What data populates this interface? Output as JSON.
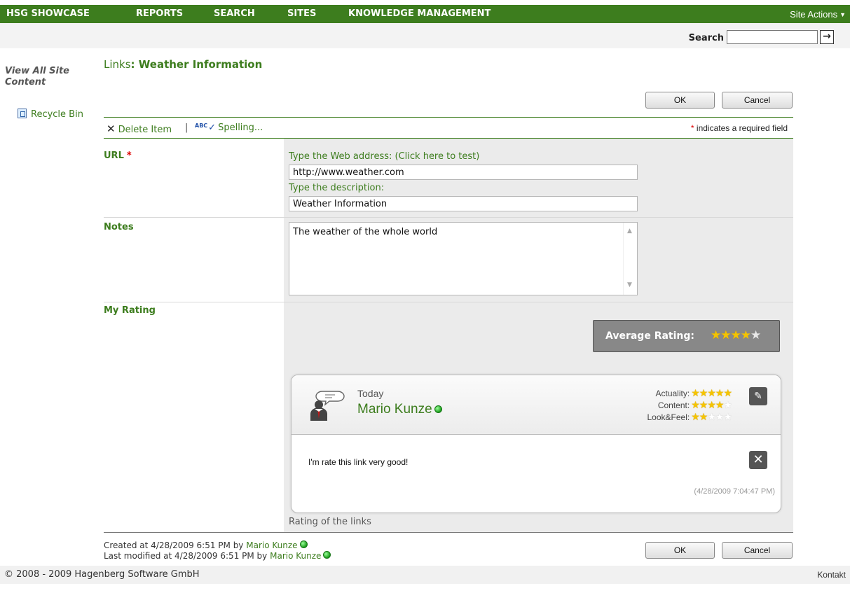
{
  "topnav": {
    "items": [
      "HSG SHOWCASE",
      "REPORTS",
      "SEARCH",
      "SITES",
      "KNOWLEDGE MANAGEMENT"
    ],
    "site_actions": "Site Actions",
    "color": "#3d7d1e"
  },
  "search": {
    "label": "Search",
    "value": "",
    "go_icon": "arrow-right-icon"
  },
  "leftnav": {
    "view_all": "View All Site Content",
    "recycle_bin": "Recycle Bin"
  },
  "title": {
    "prefix": "Links",
    "item": ": Weather Information"
  },
  "buttons": {
    "ok": "OK",
    "cancel": "Cancel"
  },
  "toolbar": {
    "delete": "Delete Item",
    "separator": "|",
    "spelling": "Spelling...",
    "required_marker": "*",
    "required_text": "indicates a required field"
  },
  "form": {
    "url": {
      "label": "URL",
      "required": "*",
      "address_label": "Type the Web address: (Click here to test)",
      "address_value": "http://www.weather.com",
      "description_label": "Type the description:",
      "description_value": "Weather Information"
    },
    "notes": {
      "label": "Notes",
      "value": "The weather of the whole world"
    },
    "rating": {
      "label": "My Rating",
      "average_label": "Average Rating:",
      "average_stars": 4.5,
      "card": {
        "when": "Today",
        "user": "Mario Kunze",
        "criteria": [
          {
            "name": "Actuality:",
            "stars": 5
          },
          {
            "name": "Content:",
            "stars": 4
          },
          {
            "name": "Look&Feel:",
            "stars": 2
          }
        ],
        "comment": "I'm rate this link very good!",
        "timestamp": "(4/28/2009 7:04:47 PM)"
      },
      "caption": "Rating of the links"
    }
  },
  "meta": {
    "created_prefix": "Created at 4/28/2009 6:51 PM  by",
    "created_by": "Mario Kunze",
    "modified_prefix": "Last modified at 4/28/2009 6:51 PM  by",
    "modified_by": "Mario Kunze"
  },
  "footer": {
    "copyright": "© 2008 - 2009 Hagenberg Software GmbH",
    "contact": "Kontakt"
  }
}
